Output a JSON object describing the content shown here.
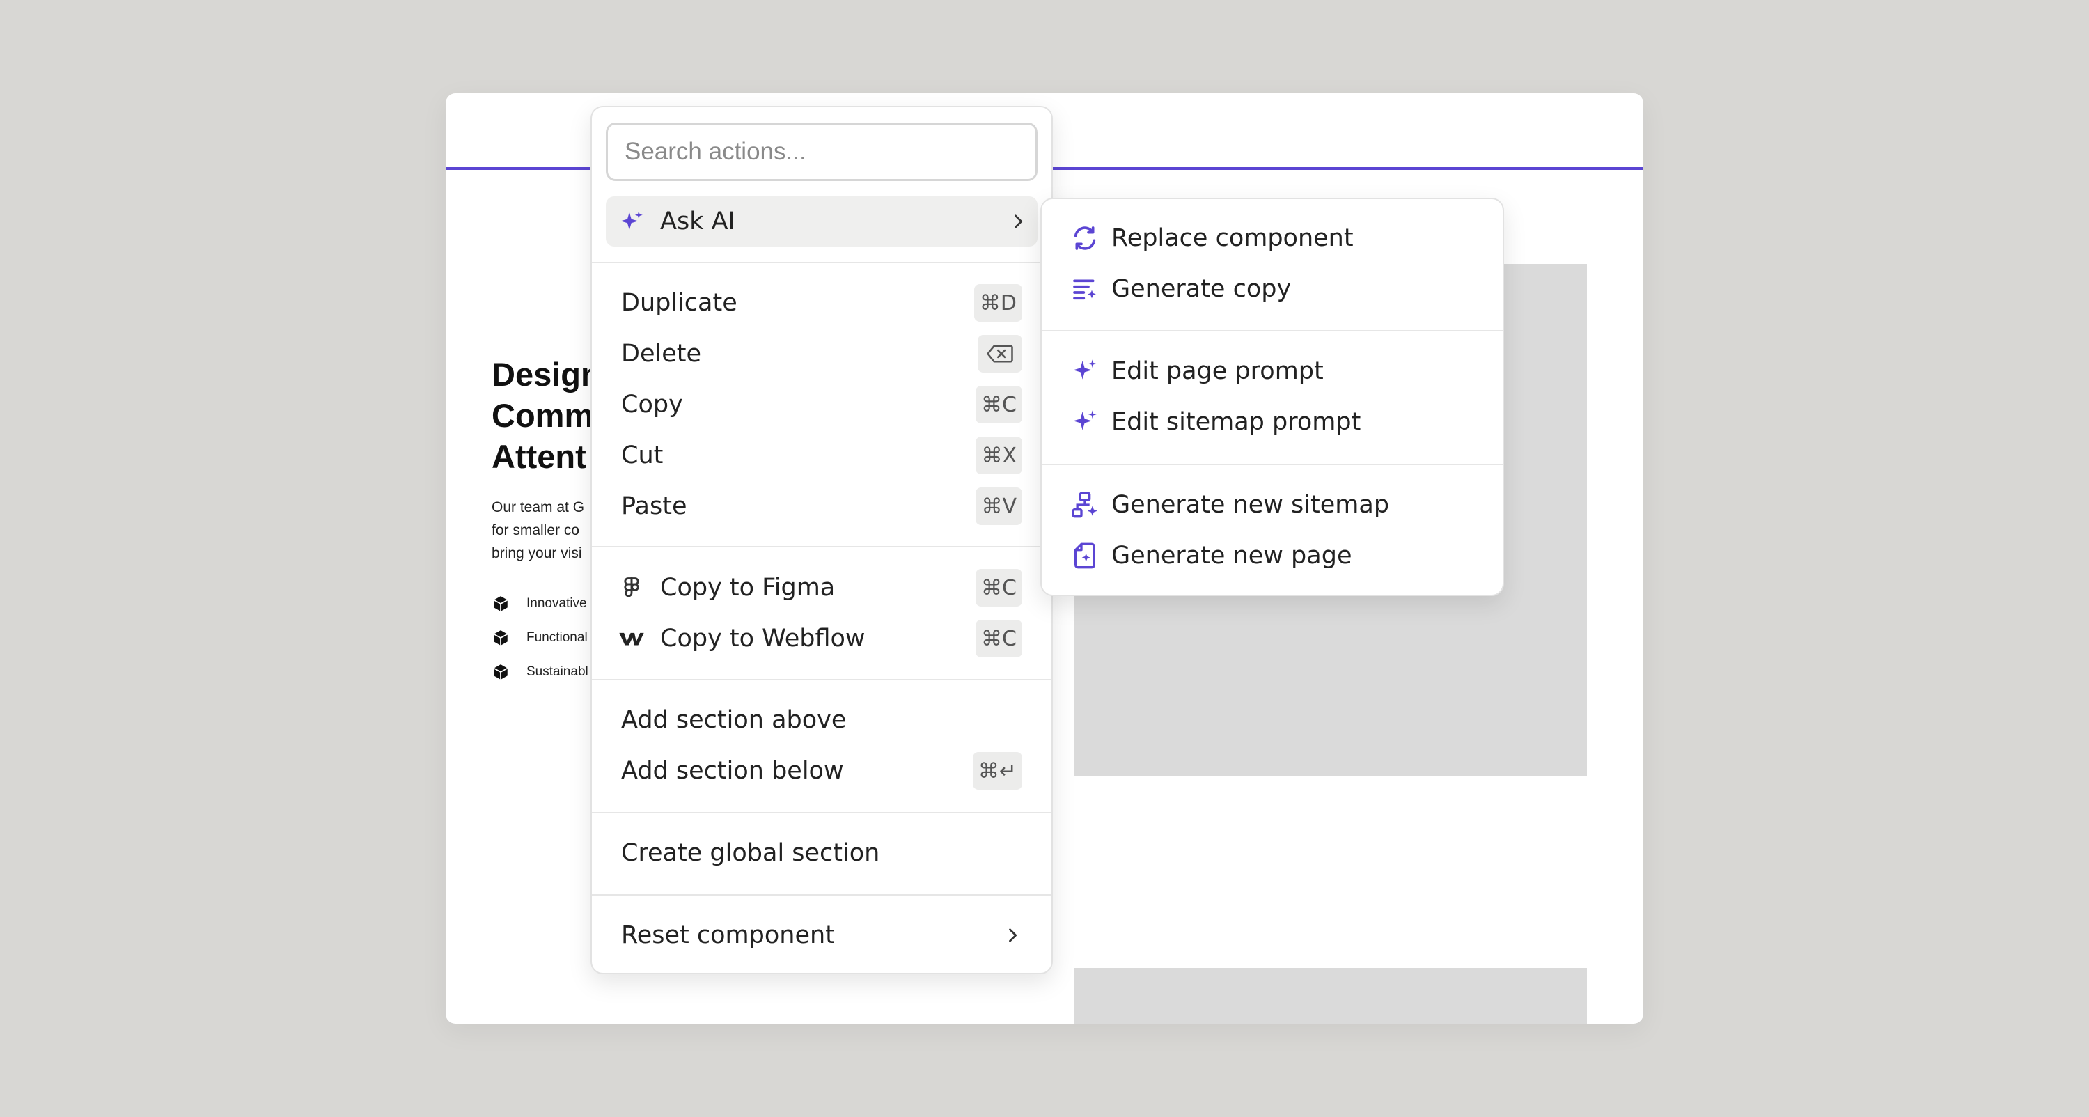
{
  "background_page": {
    "hero_title": "Design\nComm\nAttent",
    "hero_body": "Our team at G\nfor smaller co\nbring your visi",
    "features": [
      "Innovative",
      "Functional",
      "Sustainabl"
    ]
  },
  "menu": {
    "search_placeholder": "Search actions...",
    "ask_ai_label": "Ask AI",
    "items": {
      "duplicate": {
        "label": "Duplicate",
        "shortcut": "⌘D"
      },
      "delete": {
        "label": "Delete"
      },
      "copy": {
        "label": "Copy",
        "shortcut": "⌘C"
      },
      "cut": {
        "label": "Cut",
        "shortcut": "⌘X"
      },
      "paste": {
        "label": "Paste",
        "shortcut": "⌘V"
      },
      "copy_to_figma": {
        "label": "Copy to Figma",
        "shortcut": "⌘C"
      },
      "copy_to_webflow": {
        "label": "Copy to Webflow",
        "shortcut": "⌘C"
      },
      "add_section_above": {
        "label": "Add section above"
      },
      "add_section_below": {
        "label": "Add section below",
        "shortcut": "⌘↵"
      },
      "create_global_section": {
        "label": "Create global section"
      },
      "reset_component": {
        "label": "Reset component"
      }
    }
  },
  "submenu": {
    "items": {
      "replace_component": "Replace component",
      "generate_copy": "Generate copy",
      "edit_page_prompt": "Edit page prompt",
      "edit_sitemap_prompt": "Edit sitemap prompt",
      "generate_new_sitemap": "Generate new sitemap",
      "generate_new_page": "Generate new page"
    }
  },
  "colors": {
    "accent": "#5b45d3",
    "page_background": "#d8d7d4",
    "placeholder_block": "#dadada",
    "hover_row": "#efefee"
  }
}
